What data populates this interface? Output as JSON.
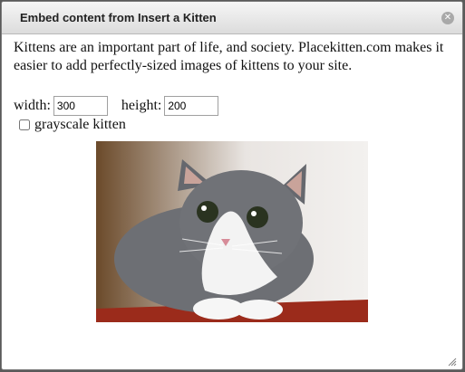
{
  "dialog": {
    "title": "Embed content from Insert a Kitten",
    "close_icon": "close-icon",
    "intro": "Kittens are an important part of life, and society. Placekitten.com makes it easier to add perfectly-sized images of kittens to your site.",
    "width_label": "width:",
    "width_value": "300",
    "height_label": "height:",
    "height_value": "200",
    "grayscale_label": "grayscale kitten",
    "grayscale_checked": false,
    "image_icon": "kitten-photo",
    "resize_icon": "resize-grip-icon"
  }
}
